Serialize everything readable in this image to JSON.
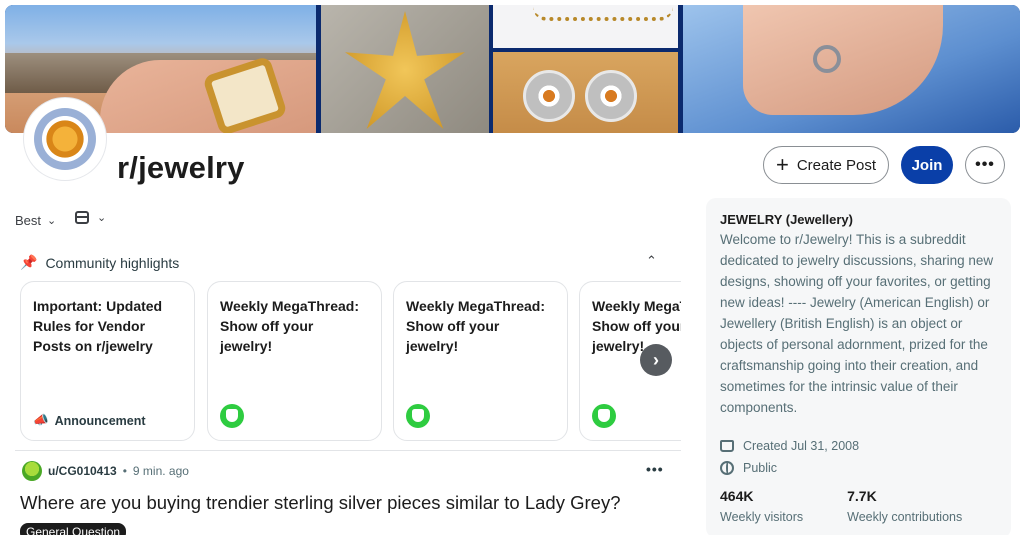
{
  "subreddit": {
    "name": "r/jewelry"
  },
  "header": {
    "create_post_label": "Create Post",
    "join_label": "Join",
    "more_label": "•••"
  },
  "feed": {
    "sort_label": "Best",
    "highlights_title": "Community highlights",
    "highlights": [
      {
        "title": "Important: Updated Rules for Vendor Posts on r/jewelry",
        "footer": "Announcement",
        "footer_icon": "megaphone-icon"
      },
      {
        "title": "Weekly MegaThread: Show off your jewelry!",
        "footer_icon": "mod-shield-icon"
      },
      {
        "title": "Weekly MegaThread: Show off your jewelry!",
        "footer_icon": "mod-shield-icon"
      },
      {
        "title": "Weekly MegaThread: Show off your jewelry!",
        "footer_icon": "mod-shield-icon"
      }
    ],
    "post": {
      "author": "u/CG010413",
      "separator": "•",
      "time": "9 min. ago",
      "title": "Where are you buying trendier sterling silver pieces similar to Lady Grey?",
      "flair": "General Question"
    }
  },
  "sidebar": {
    "name": "JEWELRY (Jewellery)",
    "description": "Welcome to r/Jewelry! This is a subreddit dedicated to jewelry discussions, sharing new designs, showing off your favorites, or getting new ideas! ---- Jewelry (American English) or Jewellery (British English) is an object or objects of personal adornment, prized for the craftsmanship going into their creation, and sometimes for the intrinsic value of their components.",
    "created": "Created Jul 31, 2008",
    "visibility": "Public",
    "stats": [
      {
        "value": "464K",
        "label": "Weekly visitors"
      },
      {
        "value": "7.7K",
        "label": "Weekly contributions"
      }
    ]
  },
  "colors": {
    "join_button": "#0a3fa8",
    "mod_shield": "#2ecc40"
  }
}
